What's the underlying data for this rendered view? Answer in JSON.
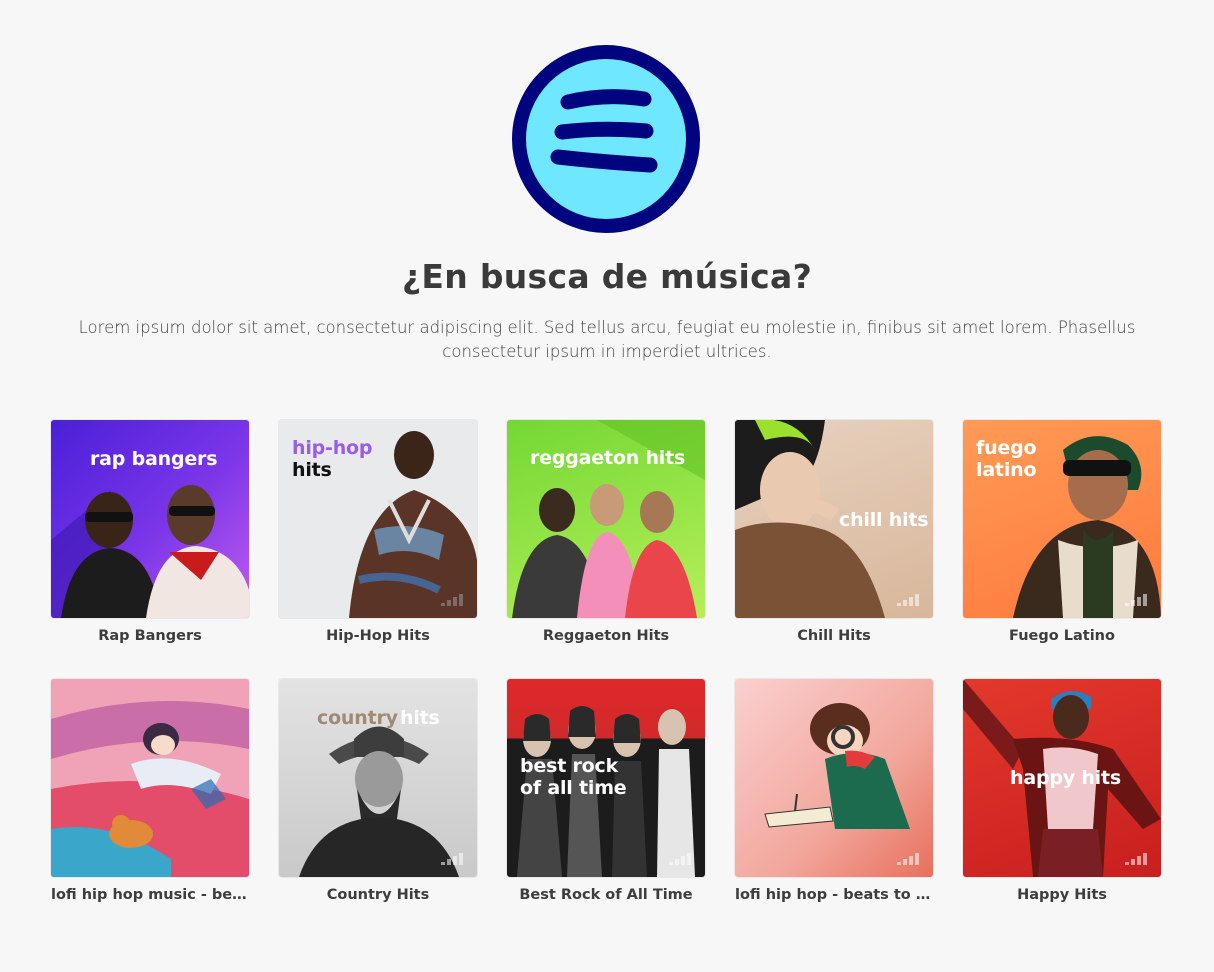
{
  "header": {
    "logo_icon": "music-waves-logo",
    "title": "¿En busca de música?",
    "subtitle": "Lorem ipsum dolor sit amet, consectetur adipiscing elit. Sed tellus arcu, feugiat eu molestie in, finibus sit amet lorem. Phasellus consectetur ipsum in imperdiet ultrices."
  },
  "colors": {
    "logo_ring": "#00047e",
    "logo_fill": "#6fe8ff",
    "background": "#f7f7f7"
  },
  "playlists": [
    {
      "label": "Rap Bangers",
      "cover_line1": "rap bangers",
      "cover_line2": ""
    },
    {
      "label": "Hip-Hop Hits",
      "cover_line1": "hip-hop",
      "cover_line2": "hits"
    },
    {
      "label": "Reggaeton Hits",
      "cover_line1": "reggaeton hits",
      "cover_line2": ""
    },
    {
      "label": "Chill Hits",
      "cover_line1": "chill hits",
      "cover_line2": ""
    },
    {
      "label": "Fuego Latino",
      "cover_line1": "fuego",
      "cover_line2": "latino"
    },
    {
      "label": "lofi hip hop music - beat…",
      "cover_line1": "",
      "cover_line2": ""
    },
    {
      "label": "Country Hits",
      "cover_line1": "country",
      "cover_line2": "hits"
    },
    {
      "label": "Best Rock of All Time",
      "cover_line1": "best rock",
      "cover_line2": "of all time"
    },
    {
      "label": "lofi hip hop - beats to rel…",
      "cover_line1": "",
      "cover_line2": ""
    },
    {
      "label": "Happy Hits",
      "cover_line1": "happy hits",
      "cover_line2": ""
    }
  ]
}
